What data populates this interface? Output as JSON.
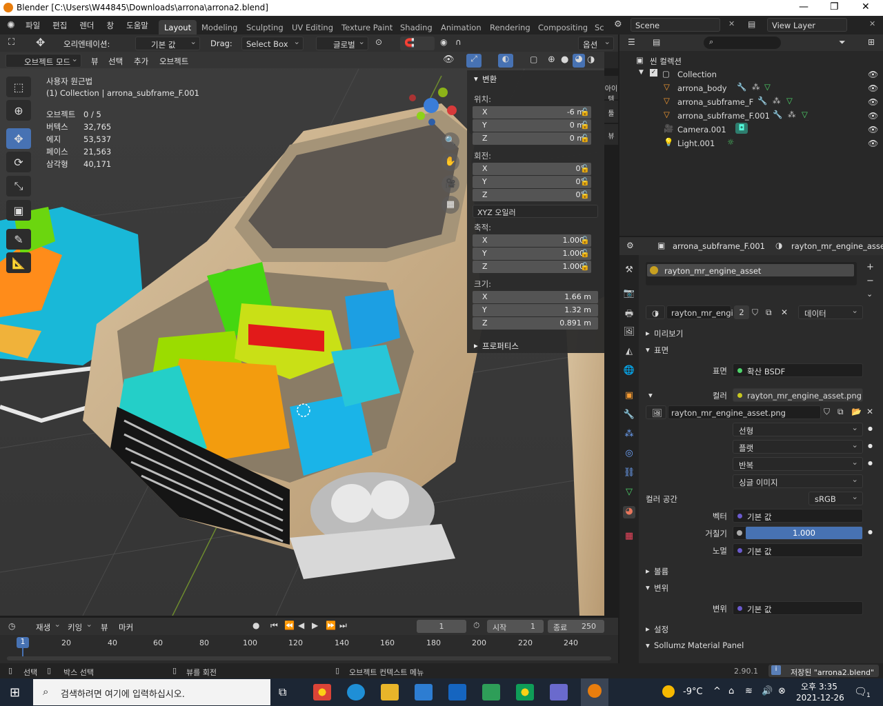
{
  "window": {
    "title": "Blender [C:\\Users\\W44845\\Downloads\\arrona\\arrona2.blend]",
    "min": "—",
    "max": "❐",
    "close": "✕"
  },
  "menu": [
    "파일",
    "편집",
    "렌더",
    "창",
    "도움말"
  ],
  "workspaces": [
    "Layout",
    "Modeling",
    "Sculpting",
    "UV Editing",
    "Texture Paint",
    "Shading",
    "Animation",
    "Rendering",
    "Compositing",
    "Sc"
  ],
  "scene": {
    "name": "Scene",
    "view_layer": "View Layer"
  },
  "vp_header": {
    "orientation_label": "오리엔테이션:",
    "orientation_value": "기본 값",
    "drag_label": "Drag:",
    "drag_value": "Select Box",
    "transform_space": "글로벌",
    "options": "옵션"
  },
  "vp_header2": {
    "mode": "오브젝트 모드",
    "view": "뷰",
    "select": "선택",
    "add": "추가",
    "object": "오브젝트"
  },
  "overlay_text": {
    "view_name": "사용자 원근법",
    "collection_line": "(1) Collection | arrona_subframe_F.001",
    "stats": [
      {
        "label": "오브젝트",
        "value": "0 / 5"
      },
      {
        "label": "버텍스",
        "value": "32,765"
      },
      {
        "label": "에지",
        "value": "53,537"
      },
      {
        "label": "페이스",
        "value": "21,563"
      },
      {
        "label": "삼각형",
        "value": "40,171"
      }
    ]
  },
  "npanel": {
    "header": "변환",
    "location_label": "위치:",
    "location": [
      {
        "axis": "X",
        "value": "-6 m"
      },
      {
        "axis": "Y",
        "value": "0 m"
      },
      {
        "axis": "Z",
        "value": "0 m"
      }
    ],
    "rotation_label": "회전:",
    "rotation": [
      {
        "axis": "X",
        "value": "0°"
      },
      {
        "axis": "Y",
        "value": "0°"
      },
      {
        "axis": "Z",
        "value": "0°"
      }
    ],
    "rotation_mode": "XYZ 오일러",
    "scale_label": "축적:",
    "scale": [
      {
        "axis": "X",
        "value": "1.000"
      },
      {
        "axis": "Y",
        "value": "1.000"
      },
      {
        "axis": "Z",
        "value": "1.000"
      }
    ],
    "dimensions_label": "크기:",
    "dimensions": [
      {
        "axis": "X",
        "value": "1.66 m"
      },
      {
        "axis": "Y",
        "value": "1.32 m"
      },
      {
        "axis": "Z",
        "value": "0.891 m"
      }
    ],
    "properties": "프로퍼티스"
  },
  "vtabs": [
    "아이템",
    "툴",
    "뷰"
  ],
  "outliner": {
    "root": "씬 컬렉션",
    "items": [
      {
        "name": "Collection"
      },
      {
        "name": "arrona_body"
      },
      {
        "name": "arrona_subframe_F"
      },
      {
        "name": "arrona_subframe_F.001"
      },
      {
        "name": "Camera.001"
      },
      {
        "name": "Light.001"
      }
    ]
  },
  "props": {
    "object": "arrona_subframe_F.001",
    "material": "rayton_mr_engine_asset",
    "slot": "rayton_mr_engine_asset",
    "mat_field": "rayton_mr_engi...",
    "users": "2",
    "link": "데이터",
    "preview": "미리보기",
    "surface_section": "표면",
    "surface_label": "표면",
    "surface_value": "확산 BSDF",
    "color_label": "컬러",
    "color_value": "rayton_mr_engine_asset.png",
    "image_name": "rayton_mr_engine_asset.png",
    "interp": "선형",
    "projection": "플랫",
    "extension": "반복",
    "source": "싱글 이미지",
    "colorspace_label": "컬러 공간",
    "colorspace_value": "sRGB",
    "vector_label": "벡터",
    "vector_value": "기본 값",
    "roughness_label": "거칠기",
    "roughness_value": "1.000",
    "normal_label": "노멀",
    "normal_value": "기본 값",
    "volume": "볼륨",
    "displacement_section": "변위",
    "displacement_label": "변위",
    "displacement_value": "기본 값",
    "settings": "설정",
    "sollumz": "Sollumz Material Panel"
  },
  "timeline": {
    "playback": "재생",
    "keying": "키잉",
    "view": "뷰",
    "marker": "마커",
    "frame": "1",
    "start_label": "시작",
    "start": "1",
    "end_label": "종료",
    "end": "250",
    "ticks": [
      "20",
      "40",
      "60",
      "80",
      "100",
      "120",
      "140",
      "160",
      "180",
      "200",
      "220",
      "240"
    ],
    "current": "1"
  },
  "status": {
    "select": "선택",
    "box_select": "박스 선택",
    "rotate_view": "뷰를 회전",
    "context_menu": "오브젝트 컨텍스트 메뉴",
    "version": "2.90.1",
    "saved": "저장된 \"arrona2.blend\""
  },
  "taskbar": {
    "search_placeholder": "검색하려면 여기에 입력하십시오.",
    "weather": "-9°C",
    "time": "오후 3:35",
    "date": "2021-12-26",
    "notif": "1"
  }
}
